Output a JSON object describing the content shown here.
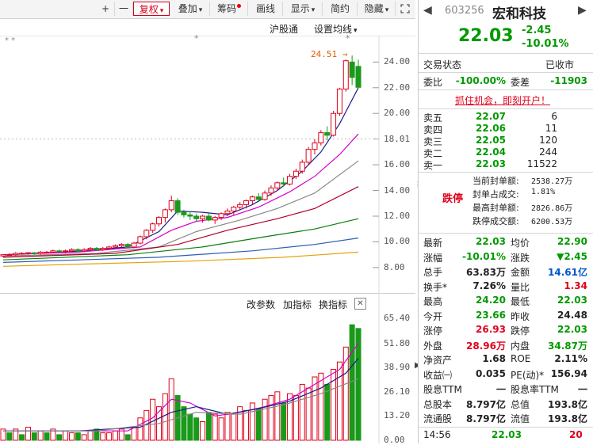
{
  "toolbar": {
    "plus": "+",
    "minus": "一",
    "fuquan": "复权",
    "diejia": "叠加",
    "chouma": "筹码",
    "huaxian": "画线",
    "xianshi": "显示",
    "jianyue": "简约",
    "yincang": "隐藏"
  },
  "chart": {
    "hugutong": "沪股通",
    "shezhi_junxian": "设置均线",
    "high_label": "24.51",
    "current_price_tag": "18.01",
    "price_ticks": [
      "24.00",
      "22.00",
      "20.00",
      "18.01",
      "16.00",
      "14.00",
      "12.00",
      "10.00",
      "8.00"
    ],
    "vol_ticks": [
      "65.40",
      "51.80",
      "38.90",
      "26.10",
      "13.20",
      "0.00"
    ],
    "vol_toolbar": {
      "gai": "改参数",
      "jia": "加指标",
      "huan": "换指标",
      "close": "✕"
    }
  },
  "chart_data": {
    "type": "candlestick",
    "ylim": [
      7.5,
      25.5
    ],
    "vol_ylim": [
      0,
      68
    ],
    "candles": [
      [
        8.9,
        9.0,
        8.8,
        9.0
      ],
      [
        9.0,
        9.1,
        8.9,
        9.0
      ],
      [
        9.0,
        9.2,
        8.9,
        9.1
      ],
      [
        9.1,
        9.2,
        9.0,
        9.1
      ],
      [
        9.1,
        9.2,
        9.0,
        9.15
      ],
      [
        9.15,
        9.2,
        9.0,
        9.1
      ],
      [
        9.1,
        9.3,
        9.0,
        9.2
      ],
      [
        9.2,
        9.3,
        9.1,
        9.2
      ],
      [
        9.2,
        9.4,
        9.1,
        9.3
      ],
      [
        9.3,
        9.4,
        9.2,
        9.25
      ],
      [
        9.25,
        9.4,
        9.1,
        9.3
      ],
      [
        9.3,
        9.5,
        9.2,
        9.4
      ],
      [
        9.4,
        9.5,
        9.2,
        9.3
      ],
      [
        9.3,
        9.5,
        9.2,
        9.4
      ],
      [
        9.4,
        9.6,
        9.3,
        9.5
      ],
      [
        9.5,
        9.6,
        9.3,
        9.4
      ],
      [
        9.4,
        9.6,
        9.3,
        9.5
      ],
      [
        9.5,
        9.7,
        9.4,
        9.6
      ],
      [
        9.6,
        9.8,
        9.5,
        9.7
      ],
      [
        9.7,
        9.9,
        9.6,
        9.8
      ],
      [
        9.8,
        9.9,
        9.5,
        9.6
      ],
      [
        9.6,
        10.0,
        9.5,
        9.9
      ],
      [
        9.9,
        10.5,
        9.8,
        10.4
      ],
      [
        10.4,
        11.0,
        10.2,
        10.9
      ],
      [
        10.9,
        11.5,
        10.7,
        11.4
      ],
      [
        11.4,
        12.0,
        11.2,
        11.9
      ],
      [
        11.9,
        12.6,
        11.5,
        12.5
      ],
      [
        12.5,
        13.6,
        12.3,
        13.2
      ],
      [
        13.2,
        13.4,
        12.1,
        12.3
      ],
      [
        12.3,
        12.5,
        11.9,
        12.1
      ],
      [
        12.1,
        12.4,
        11.7,
        12.0
      ],
      [
        12.0,
        12.2,
        11.6,
        11.8
      ],
      [
        11.8,
        12.1,
        11.5,
        12.0
      ],
      [
        12.0,
        12.3,
        11.6,
        11.7
      ],
      [
        11.7,
        12.0,
        11.4,
        11.9
      ],
      [
        11.9,
        12.3,
        11.7,
        12.2
      ],
      [
        12.2,
        12.6,
        12.0,
        12.4
      ],
      [
        12.4,
        12.8,
        12.1,
        12.7
      ],
      [
        12.7,
        13.1,
        12.5,
        12.9
      ],
      [
        12.9,
        13.3,
        12.6,
        13.2
      ],
      [
        13.2,
        13.6,
        12.9,
        13.5
      ],
      [
        13.5,
        13.8,
        13.1,
        13.3
      ],
      [
        13.3,
        14.0,
        13.2,
        13.8
      ],
      [
        13.8,
        14.4,
        13.6,
        14.2
      ],
      [
        14.2,
        14.7,
        14.0,
        14.6
      ],
      [
        14.6,
        15.0,
        14.3,
        14.5
      ],
      [
        14.5,
        15.3,
        14.4,
        15.1
      ],
      [
        15.1,
        15.7,
        14.9,
        15.5
      ],
      [
        15.5,
        16.4,
        15.3,
        16.2
      ],
      [
        16.2,
        17.4,
        16.0,
        17.2
      ],
      [
        17.2,
        18.0,
        16.8,
        17.7
      ],
      [
        17.7,
        18.7,
        17.5,
        18.5
      ],
      [
        18.5,
        19.0,
        17.9,
        18.3
      ],
      [
        18.3,
        20.2,
        18.2,
        20.0
      ],
      [
        20.0,
        22.0,
        19.8,
        21.9
      ],
      [
        21.9,
        24.2,
        21.7,
        24.1
      ],
      [
        24.0,
        24.51,
        22.2,
        22.8
      ],
      [
        23.66,
        24.2,
        22.03,
        22.03
      ]
    ],
    "ma": {
      "ma5": {
        "color": "#1a1a8c",
        "points": [
          [
            0,
            9.0
          ],
          [
            10,
            9.2
          ],
          [
            20,
            9.6
          ],
          [
            25,
            10.8
          ],
          [
            28,
            12.4
          ],
          [
            32,
            12.3
          ],
          [
            36,
            12.1
          ],
          [
            40,
            12.9
          ],
          [
            44,
            14.0
          ],
          [
            48,
            15.5
          ],
          [
            51,
            17.0
          ],
          [
            54,
            19.2
          ],
          [
            57,
            22.0
          ]
        ]
      },
      "ma10": {
        "color": "#d400c8",
        "points": [
          [
            0,
            9.0
          ],
          [
            12,
            9.2
          ],
          [
            22,
            9.6
          ],
          [
            27,
            10.9
          ],
          [
            31,
            11.6
          ],
          [
            36,
            11.9
          ],
          [
            41,
            12.7
          ],
          [
            46,
            13.9
          ],
          [
            50,
            15.1
          ],
          [
            54,
            16.8
          ],
          [
            57,
            18.4
          ]
        ]
      },
      "ma20": {
        "color": "#888888",
        "points": [
          [
            0,
            8.9
          ],
          [
            15,
            9.1
          ],
          [
            25,
            9.6
          ],
          [
            31,
            10.8
          ],
          [
            38,
            11.7
          ],
          [
            44,
            12.6
          ],
          [
            50,
            13.8
          ],
          [
            57,
            16.3
          ]
        ]
      },
      "ma30": {
        "color": "#b2002b",
        "points": [
          [
            0,
            8.8
          ],
          [
            18,
            9.1
          ],
          [
            28,
            9.8
          ],
          [
            36,
            10.9
          ],
          [
            44,
            11.8
          ],
          [
            50,
            12.6
          ],
          [
            57,
            14.3
          ]
        ]
      },
      "ma60": {
        "color": "#0a7d0a",
        "points": [
          [
            0,
            8.6
          ],
          [
            20,
            9.0
          ],
          [
            32,
            9.6
          ],
          [
            42,
            10.4
          ],
          [
            50,
            11.0
          ],
          [
            57,
            11.8
          ]
        ]
      },
      "ma120": {
        "color": "#2b5db6",
        "points": [
          [
            0,
            8.4
          ],
          [
            25,
            8.8
          ],
          [
            40,
            9.3
          ],
          [
            50,
            9.8
          ],
          [
            57,
            10.3
          ]
        ]
      },
      "ma250": {
        "color": "#e6a10a",
        "points": [
          [
            0,
            8.1
          ],
          [
            30,
            8.5
          ],
          [
            45,
            8.8
          ],
          [
            57,
            9.2
          ]
        ]
      }
    },
    "volume": [
      6,
      4,
      6,
      3,
      7,
      4,
      5,
      4,
      6,
      3,
      5,
      4,
      4,
      3,
      5,
      6,
      4,
      4,
      5,
      6,
      3,
      7,
      12,
      16,
      22,
      18,
      25,
      33,
      24,
      18,
      14,
      12,
      10,
      15,
      14,
      12,
      15,
      14,
      18,
      16,
      20,
      17,
      22,
      24,
      26,
      20,
      25,
      24,
      30,
      28,
      34,
      36,
      30,
      38,
      42,
      50,
      62,
      60
    ],
    "vol_up": [
      true,
      false,
      true,
      false,
      true,
      false,
      true,
      false,
      true,
      false,
      true,
      true,
      false,
      true,
      true,
      false,
      true,
      true,
      true,
      true,
      false,
      true,
      true,
      true,
      true,
      true,
      true,
      true,
      false,
      false,
      false,
      false,
      true,
      false,
      true,
      true,
      true,
      true,
      true,
      true,
      true,
      false,
      true,
      true,
      true,
      false,
      true,
      true,
      true,
      true,
      true,
      true,
      false,
      true,
      true,
      true,
      false,
      false
    ],
    "vol_ma": {
      "m5": {
        "color": "#d400c8",
        "points": [
          [
            0,
            5
          ],
          [
            10,
            5
          ],
          [
            20,
            5
          ],
          [
            24,
            12
          ],
          [
            27,
            22
          ],
          [
            30,
            20
          ],
          [
            34,
            13
          ],
          [
            38,
            15
          ],
          [
            42,
            18
          ],
          [
            46,
            22
          ],
          [
            50,
            30
          ],
          [
            54,
            38
          ],
          [
            57,
            52
          ]
        ]
      },
      "m10": {
        "color": "#1a1a8c",
        "points": [
          [
            0,
            5
          ],
          [
            12,
            5
          ],
          [
            22,
            7
          ],
          [
            27,
            15
          ],
          [
            31,
            18
          ],
          [
            36,
            14
          ],
          [
            41,
            17
          ],
          [
            46,
            21
          ],
          [
            51,
            28
          ],
          [
            55,
            36
          ],
          [
            57,
            44
          ]
        ]
      },
      "m20": {
        "color": "#888888",
        "points": [
          [
            0,
            5
          ],
          [
            15,
            5
          ],
          [
            25,
            9
          ],
          [
            31,
            15
          ],
          [
            38,
            14
          ],
          [
            45,
            19
          ],
          [
            51,
            25
          ],
          [
            57,
            33
          ]
        ]
      }
    }
  },
  "panel": {
    "code": "603256",
    "name": "宏和科技",
    "price": "22.03",
    "change": "-2.45",
    "pct": "-10.01%",
    "status_label": "交易状态",
    "status_value": "已收市",
    "weibi_label": "委比",
    "weibi_value": "-100.00%",
    "weicha_label": "委差",
    "weicha_value": "-11903",
    "promo": "抓住机会，即刻开户！",
    "asks": [
      {
        "label": "卖五",
        "price": "22.07",
        "vol": "6"
      },
      {
        "label": "卖四",
        "price": "22.06",
        "vol": "11"
      },
      {
        "label": "卖三",
        "price": "22.05",
        "vol": "120"
      },
      {
        "label": "卖二",
        "price": "22.04",
        "vol": "244"
      },
      {
        "label": "卖一",
        "price": "22.03",
        "vol": "11522"
      }
    ],
    "limit_tag": "跌停",
    "limit_rows": [
      {
        "label": "当前封单额:",
        "value": "2538.27万"
      },
      {
        "label": "封单占成交:",
        "value": "1.81%"
      },
      {
        "label": "最高封单额:",
        "value": "2826.86万"
      },
      {
        "label": "跌停成交额:",
        "value": "6200.53万"
      }
    ],
    "stats": [
      {
        "l1": "最新",
        "v1": "22.03",
        "c1": "green",
        "l2": "均价",
        "v2": "22.90",
        "c2": "green"
      },
      {
        "l1": "涨幅",
        "v1": "-10.01%",
        "c1": "green",
        "l2": "涨跌",
        "v2": "▼2.45",
        "c2": "green"
      },
      {
        "l1": "总手",
        "v1": "63.83万",
        "c1": "dark",
        "l2": "金额",
        "v2": "14.61亿",
        "c2": "blue"
      },
      {
        "l1": "换手*",
        "v1": "7.26%",
        "c1": "dark",
        "l2": "量比",
        "v2": "1.34",
        "c2": "red"
      },
      {
        "l1": "最高",
        "v1": "24.20",
        "c1": "green",
        "l2": "最低",
        "v2": "22.03",
        "c2": "green"
      },
      {
        "l1": "今开",
        "v1": "23.66",
        "c1": "green",
        "l2": "昨收",
        "v2": "24.48",
        "c2": "dark"
      },
      {
        "l1": "涨停",
        "v1": "26.93",
        "c1": "red",
        "l2": "跌停",
        "v2": "22.03",
        "c2": "green"
      },
      {
        "l1": "外盘",
        "v1": "28.96万",
        "c1": "red",
        "l2": "内盘",
        "v2": "34.87万",
        "c2": "green"
      },
      {
        "l1": "净资产",
        "v1": "1.68",
        "c1": "dark",
        "l2": "ROE",
        "v2": "2.11%",
        "c2": "dark"
      },
      {
        "l1": "收益㈠",
        "v1": "0.035",
        "c1": "dark",
        "l2": "PE(动)*",
        "v2": "156.94",
        "c2": "dark"
      },
      {
        "l1": "股息TTM",
        "v1": "一",
        "c1": "dark",
        "l2": "股息率TTM",
        "v2": "一",
        "c2": "dark"
      },
      {
        "l1": "总股本",
        "v1": "8.797亿",
        "c1": "dark",
        "l2": "总值",
        "v2": "193.8亿",
        "c2": "dark"
      },
      {
        "l1": "流通股",
        "v1": "8.797亿",
        "c1": "dark",
        "l2": "流值",
        "v2": "193.8亿",
        "c2": "dark"
      }
    ],
    "tick": {
      "time": "14:56",
      "price": "22.03",
      "vol": "20"
    }
  }
}
